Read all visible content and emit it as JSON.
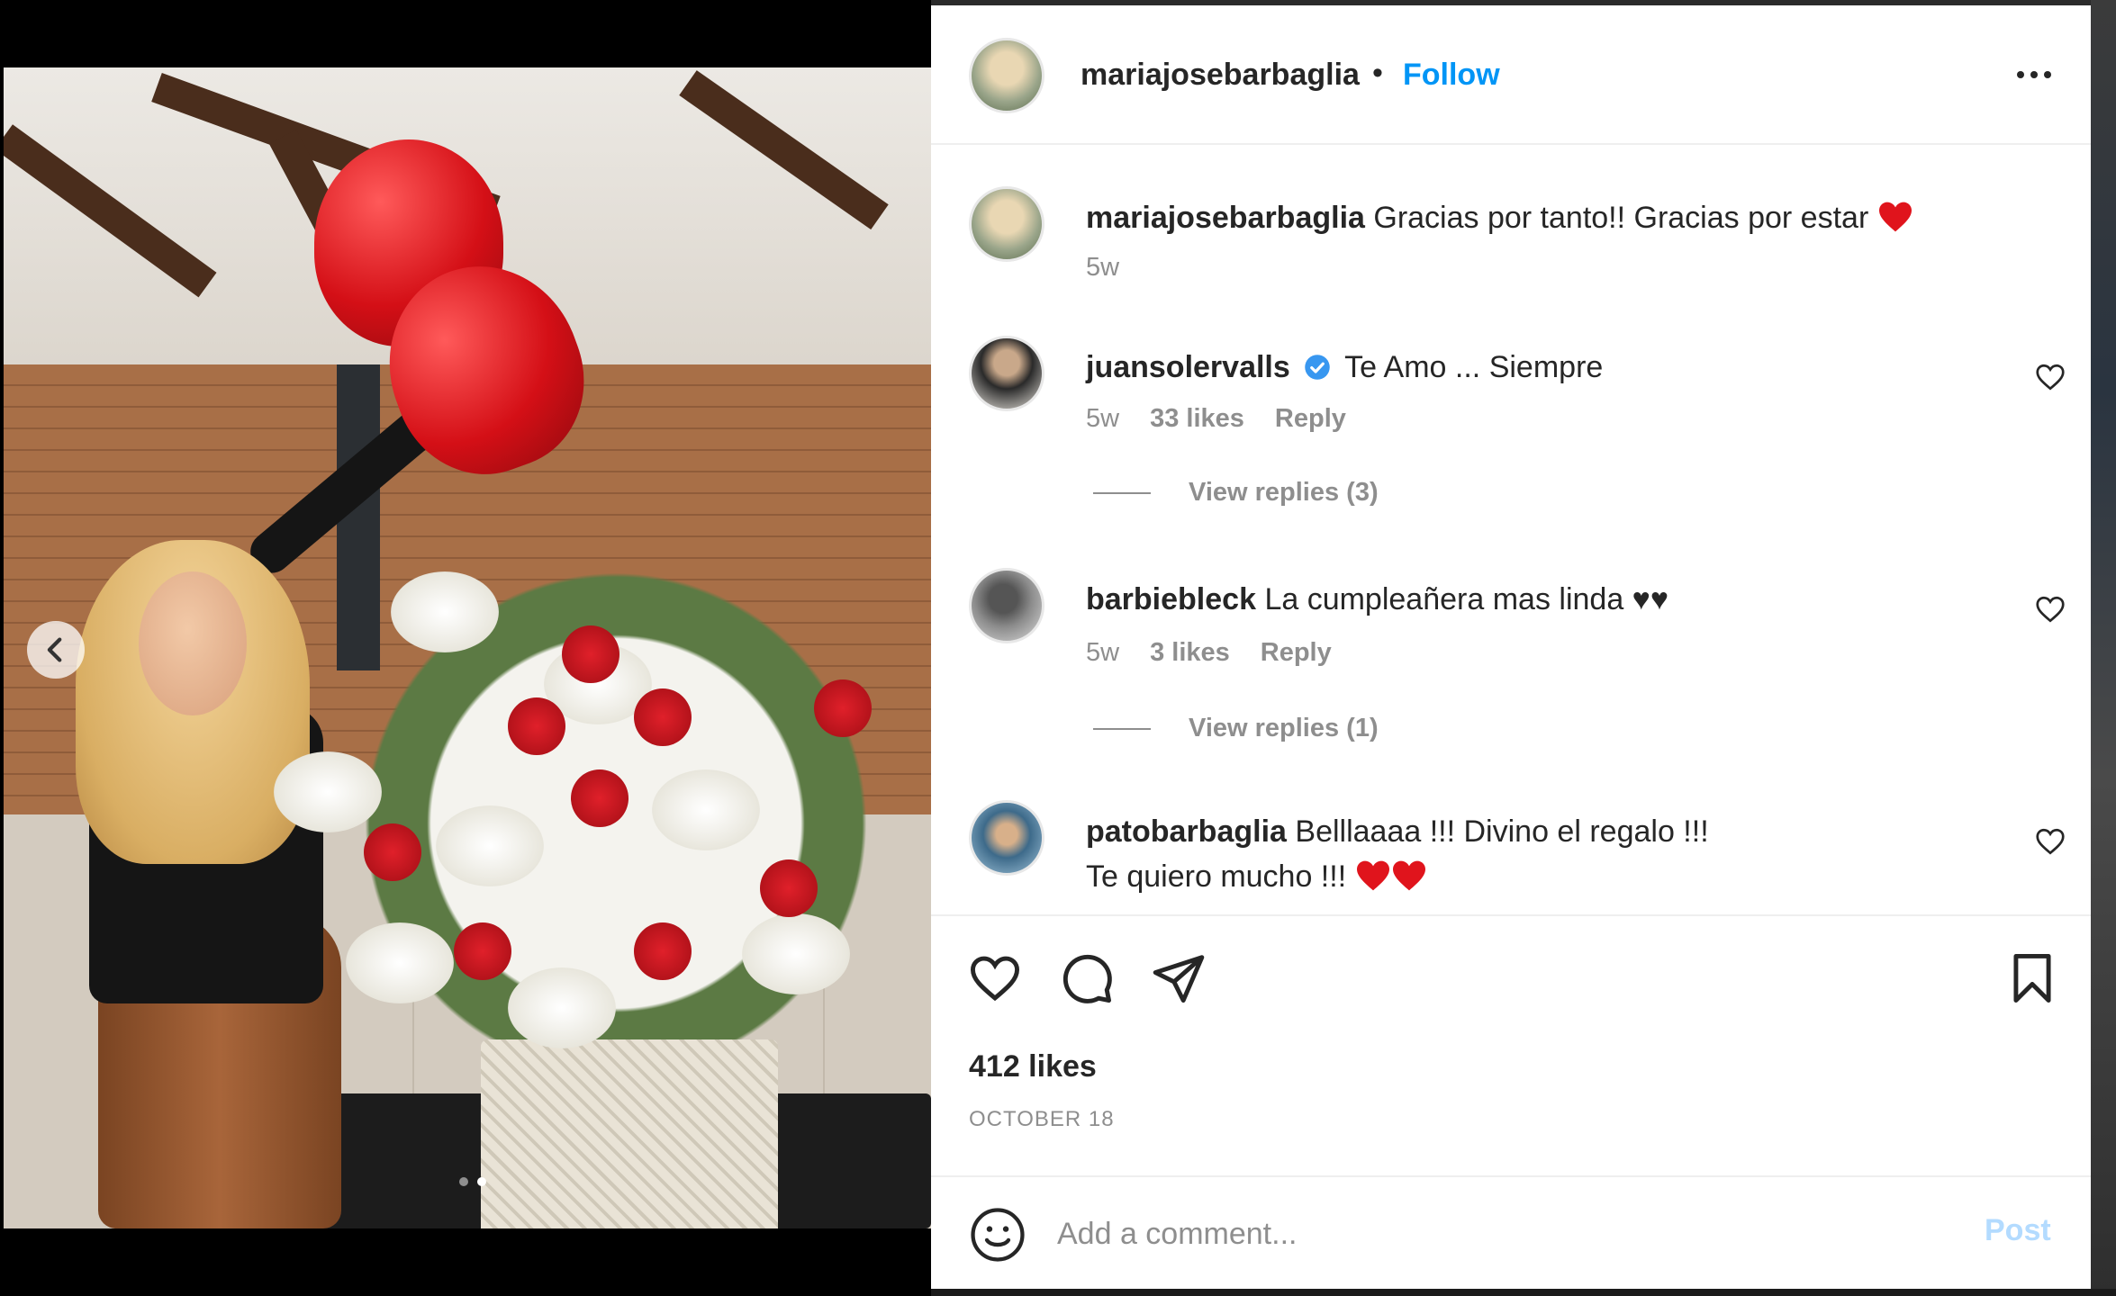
{
  "post": {
    "author": "mariajosebarbaglia",
    "separator": "•",
    "follow_label": "Follow",
    "more_icon": "more-horizontal-icon",
    "likes": "412 likes",
    "date": "OCTOBER 18"
  },
  "caption": {
    "user": "mariajosebarbaglia",
    "text": "Gracias por tanto!! Gracias por estar",
    "emoji": "red-heart",
    "time": "5w"
  },
  "comments": [
    {
      "user": "juansolervalls",
      "verified": true,
      "text": "Te Amo ... Siempre",
      "time": "5w",
      "likes": "33 likes",
      "reply_label": "Reply",
      "view_replies": "View replies (3)"
    },
    {
      "user": "barbiebleck",
      "text": "La cumpleañera mas linda ♥♥",
      "time": "5w",
      "likes": "3 likes",
      "reply_label": "Reply",
      "view_replies": "View replies (1)"
    },
    {
      "user": "patobarbaglia",
      "text_line1": "Belllaaaa !!! Divino el regalo !!!",
      "text_line2": "Te quiero mucho !!!"
    }
  ],
  "actions": {
    "like_icon": "heart-icon",
    "comment_icon": "comment-icon",
    "share_icon": "paper-plane-icon",
    "save_icon": "bookmark-icon"
  },
  "composer": {
    "emoji_icon": "smiley-icon",
    "placeholder": "Add a comment...",
    "post_label": "Post"
  },
  "colors": {
    "link_blue": "#0095f6",
    "post_disabled": "#b3dbff",
    "heart_red": "#ed4956",
    "muted": "#8e8e8e"
  },
  "carousel": {
    "prev_icon": "chevron-left-icon",
    "slides": 2,
    "active_slide": 2
  }
}
